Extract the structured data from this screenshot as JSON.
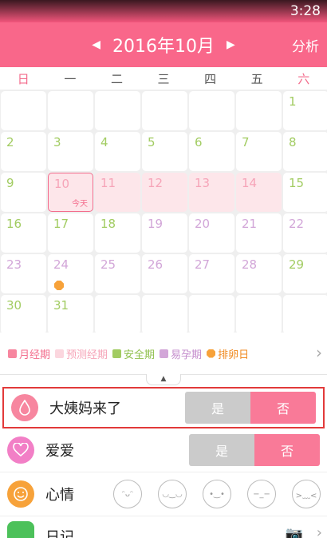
{
  "status_bar": {
    "time": "3:28"
  },
  "header": {
    "prev_icon": "◀",
    "next_icon": "▶",
    "title": "2016年10月",
    "action": "分析"
  },
  "weekdays": [
    "日",
    "一",
    "二",
    "三",
    "四",
    "五",
    "六"
  ],
  "calendar": {
    "rows": [
      [
        {
          "d": "",
          "t": "empty"
        },
        {
          "d": "",
          "t": "empty"
        },
        {
          "d": "",
          "t": "empty"
        },
        {
          "d": "",
          "t": "empty"
        },
        {
          "d": "",
          "t": "empty"
        },
        {
          "d": "",
          "t": "empty"
        },
        {
          "d": "1",
          "t": "green"
        }
      ],
      [
        {
          "d": "2",
          "t": "green"
        },
        {
          "d": "3",
          "t": "green"
        },
        {
          "d": "4",
          "t": "green"
        },
        {
          "d": "5",
          "t": "green"
        },
        {
          "d": "6",
          "t": "green"
        },
        {
          "d": "7",
          "t": "green"
        },
        {
          "d": "8",
          "t": "green"
        }
      ],
      [
        {
          "d": "9",
          "t": "green"
        },
        {
          "d": "10",
          "t": "today"
        },
        {
          "d": "11",
          "t": "predict"
        },
        {
          "d": "12",
          "t": "predict"
        },
        {
          "d": "13",
          "t": "predict"
        },
        {
          "d": "14",
          "t": "predict"
        },
        {
          "d": "15",
          "t": "green"
        }
      ],
      [
        {
          "d": "16",
          "t": "green"
        },
        {
          "d": "17",
          "t": "green"
        },
        {
          "d": "18",
          "t": "green"
        },
        {
          "d": "19",
          "t": "purple"
        },
        {
          "d": "20",
          "t": "purple"
        },
        {
          "d": "21",
          "t": "purple"
        },
        {
          "d": "22",
          "t": "purple"
        }
      ],
      [
        {
          "d": "23",
          "t": "purple"
        },
        {
          "d": "24",
          "t": "purple",
          "ovulation": true
        },
        {
          "d": "25",
          "t": "purple"
        },
        {
          "d": "26",
          "t": "purple"
        },
        {
          "d": "27",
          "t": "purple"
        },
        {
          "d": "28",
          "t": "purple"
        },
        {
          "d": "29",
          "t": "green"
        }
      ],
      [
        {
          "d": "30",
          "t": "green"
        },
        {
          "d": "31",
          "t": "green"
        },
        {
          "d": "",
          "t": "empty"
        },
        {
          "d": "",
          "t": "empty"
        },
        {
          "d": "",
          "t": "empty"
        },
        {
          "d": "",
          "t": "empty"
        },
        {
          "d": "",
          "t": "empty"
        }
      ]
    ],
    "today_label": "今天"
  },
  "legend": [
    {
      "label": "月经期",
      "color": "#f7869f",
      "text_color": "#f36c8c"
    },
    {
      "label": "预测经期",
      "color": "#fbd6de",
      "text_color": "#f6a4b8"
    },
    {
      "label": "安全期",
      "color": "#a2cc62",
      "text_color": "#8fbf4c"
    },
    {
      "label": "易孕期",
      "color": "#d2a6d8",
      "text_color": "#c48ccc"
    },
    {
      "label": "排卵日",
      "color": "#f7a23a",
      "text_color": "#f08a20"
    }
  ],
  "legend_chevron": "›",
  "collapse_icon": "▲",
  "records": {
    "period": {
      "icon": "drop-icon",
      "label": "大姨妈来了",
      "yes": "是",
      "no": "否"
    },
    "love": {
      "icon": "heart-icon",
      "label": "爱爱",
      "yes": "是",
      "no": "否"
    },
    "mood": {
      "icon": "smile-icon",
      "label": "心情",
      "faces": [
        "😌",
        "😊",
        "🙂",
        "😐",
        "😣"
      ]
    },
    "diary": {
      "icon": "note-icon",
      "label": "日记",
      "camera": "📷",
      "chevron": "›"
    }
  },
  "colors": {
    "accent": "#f9678a",
    "no_button": "#f97a98",
    "yes_button": "#cbcbcb"
  }
}
